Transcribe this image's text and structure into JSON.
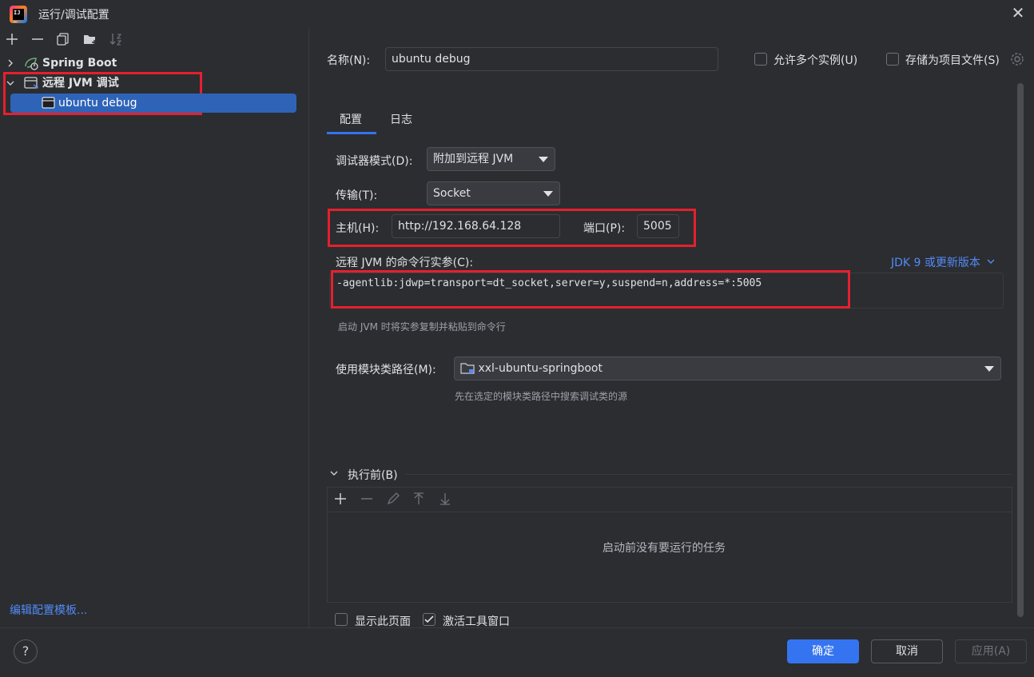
{
  "window": {
    "title": "运行/调试配置",
    "close_icon": "✕"
  },
  "left": {
    "toolbar": [
      "add-icon",
      "remove-icon",
      "copy-icon",
      "new-folder-icon",
      "sort-icon"
    ],
    "tree": {
      "group1": {
        "label": "Spring Boot",
        "expanded": false
      },
      "group2": {
        "label": "远程 JVM 调试",
        "expanded": true
      },
      "item": {
        "label": "ubuntu debug",
        "selected": true
      }
    },
    "edit_templates_link": "编辑配置模板..."
  },
  "form": {
    "name_label": "名称(N):",
    "name_value": "ubuntu debug",
    "allow_multiple_label": "允许多个实例(U)",
    "store_as_project_label": "存储为项目文件(S)",
    "tabs": [
      {
        "label": "配置",
        "active": true
      },
      {
        "label": "日志",
        "active": false
      }
    ],
    "debugger_mode_label": "调试器模式(D):",
    "debugger_mode_value": "附加到远程 JVM",
    "transport_label": "传输(T):",
    "transport_value": "Socket",
    "host_label": "主机(H):",
    "host_value": "http://192.168.64.128",
    "port_label": "端口(P):",
    "port_value": "5005",
    "cmdline_label": "远程 JVM 的命令行实参(C):",
    "jdk_version_link": "JDK 9 或更新版本",
    "cmdline_value": "-agentlib:jdwp=transport=dt_socket,server=y,suspend=n,address=*:5005",
    "cmdline_hint": "启动 JVM 时将实参复制并粘贴到命令行",
    "module_label": "使用模块类路径(M):",
    "module_value": "xxl-ubuntu-springboot",
    "module_hint": "先在选定的模块类路径中搜索调试类的源",
    "before_launch_label": "执行前(B)",
    "before_launch_empty": "启动前没有要运行的任务",
    "show_page_label": "显示此页面",
    "show_page_checked": false,
    "activate_tool_label": "激活工具窗口",
    "activate_tool_checked": true
  },
  "buttons": {
    "ok": "确定",
    "cancel": "取消",
    "apply": "应用(A)",
    "help": "?"
  },
  "colors": {
    "accent": "#3574f0",
    "highlight": "#e5202e",
    "background": "#2b2d30"
  }
}
